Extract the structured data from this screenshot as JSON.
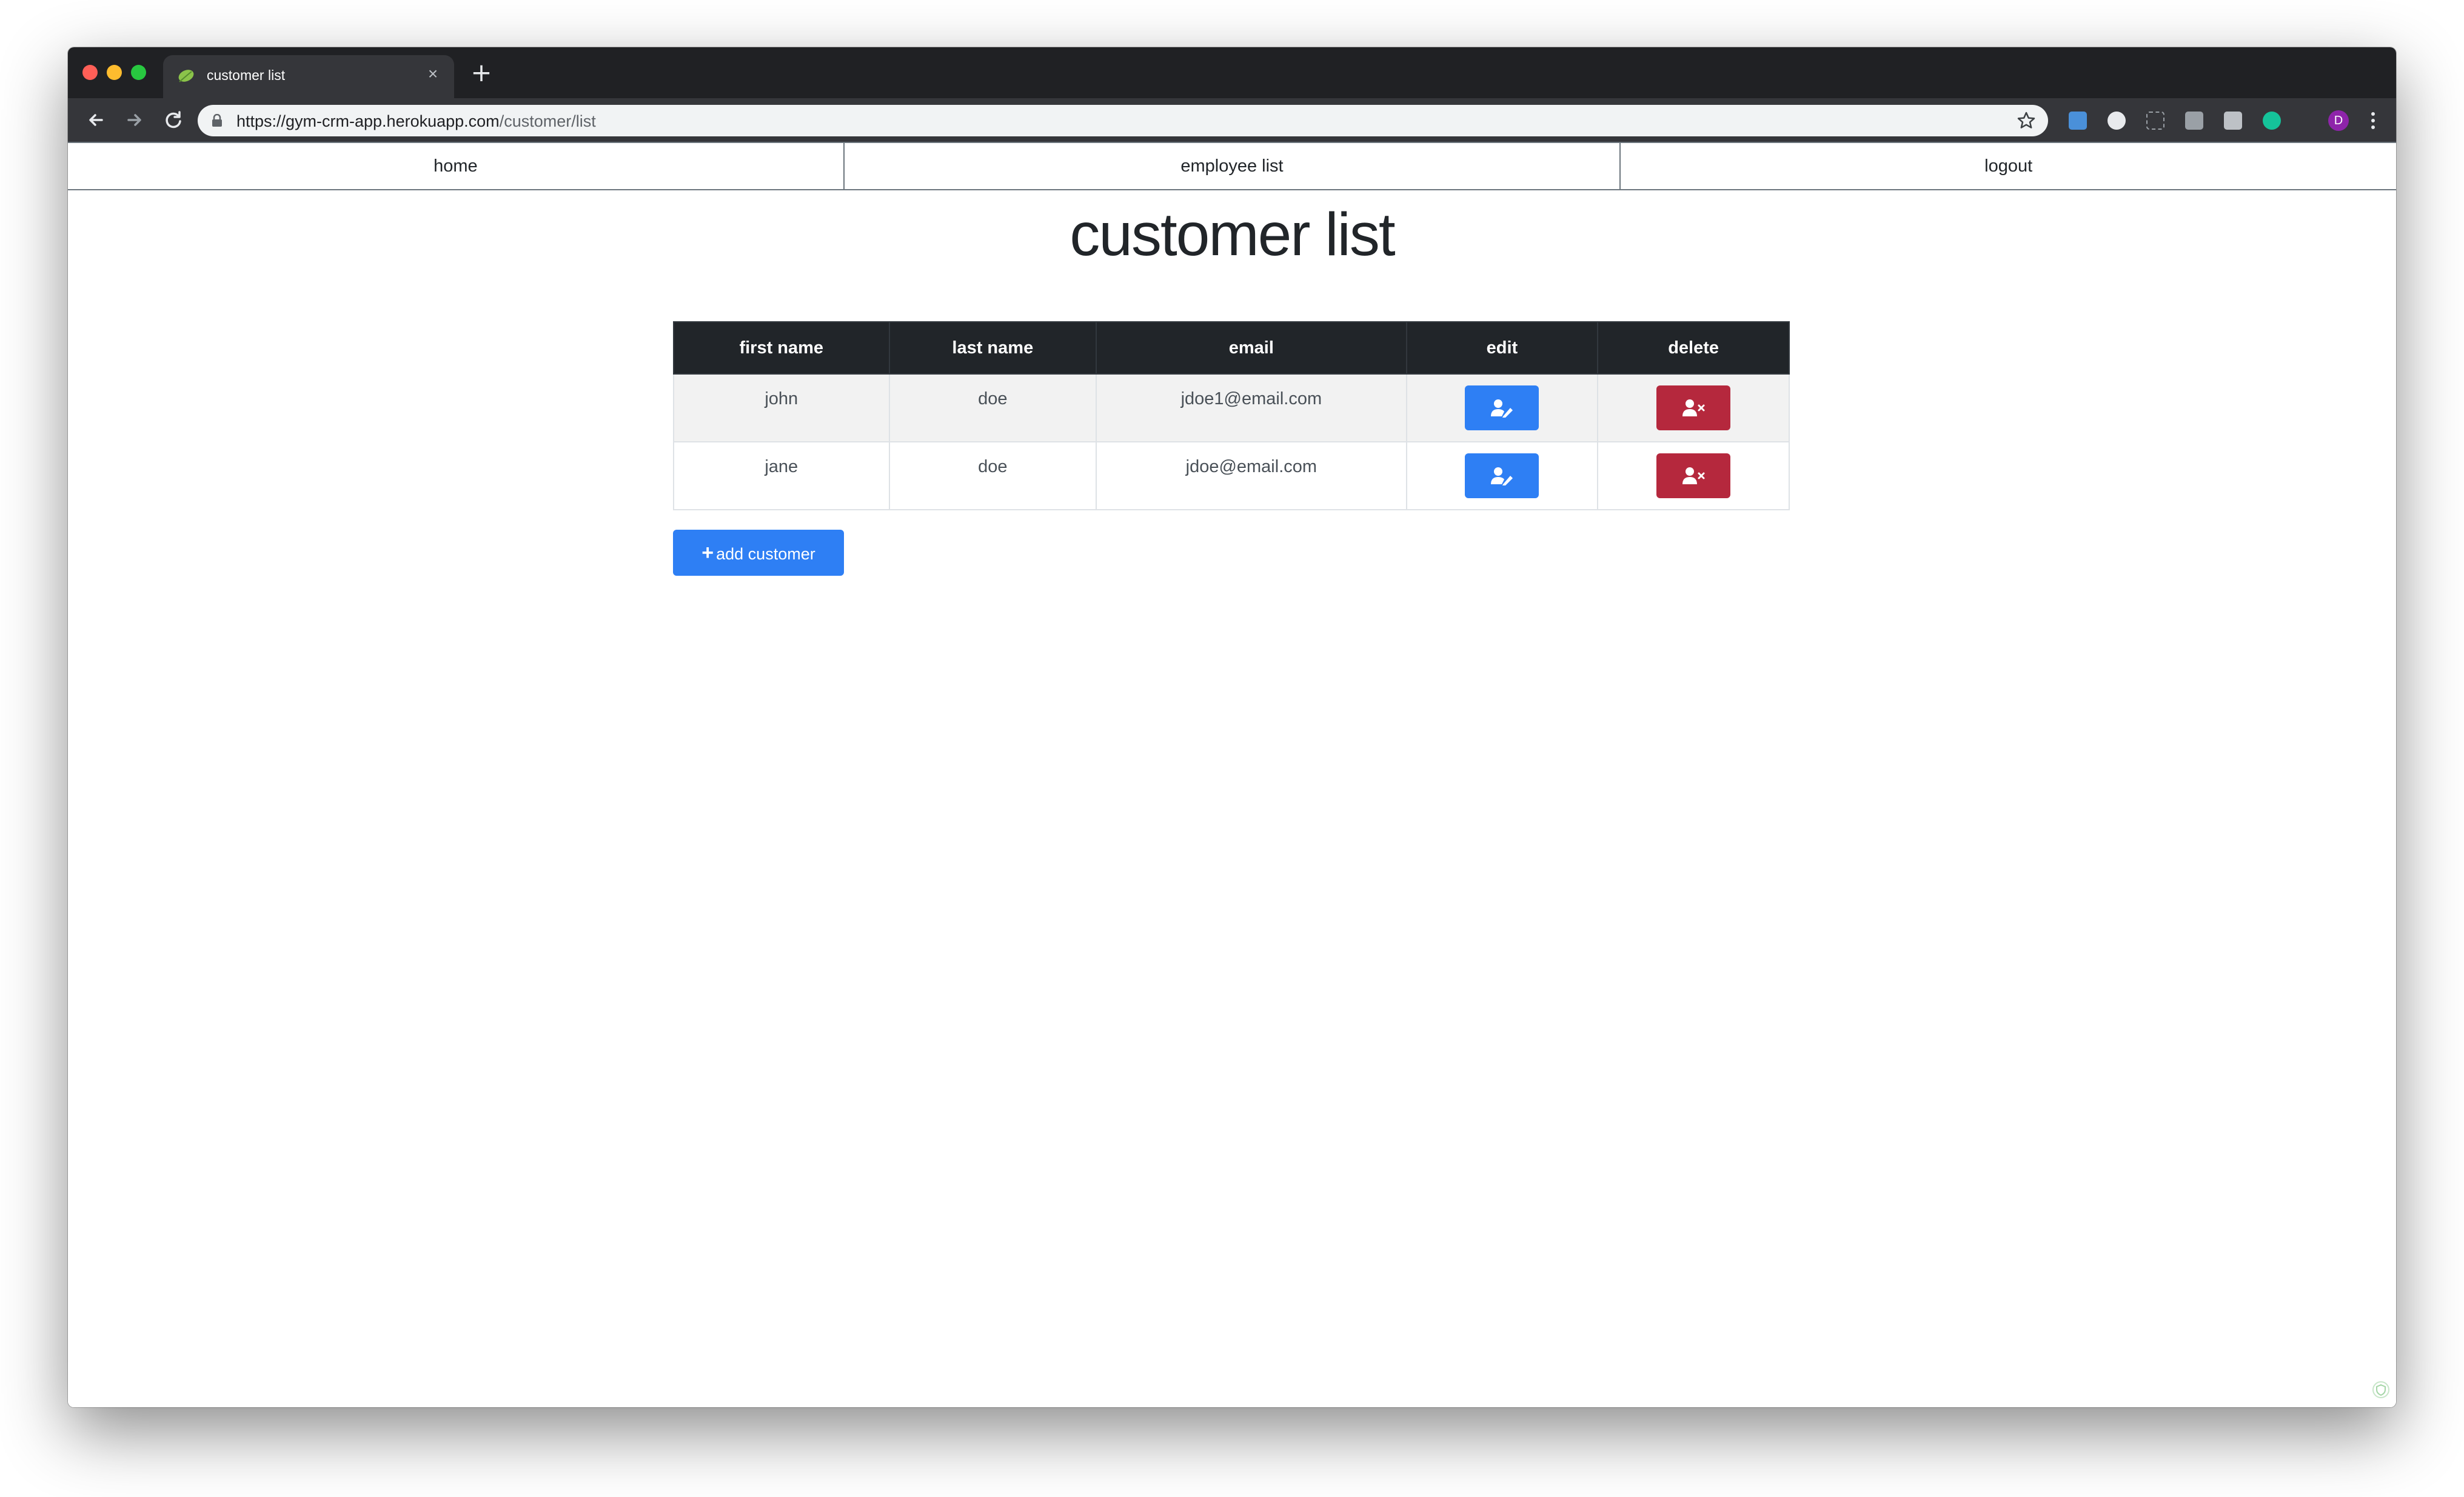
{
  "browser": {
    "tab_title": "customer list",
    "new_tab_label": "+",
    "close_label": "×",
    "url_host": "https://gym-crm-app.herokuapp.com",
    "url_path": "/customer/list",
    "profile_initial": "D"
  },
  "nav": {
    "home": "home",
    "employee_list": "employee list",
    "logout": "logout"
  },
  "page": {
    "title": "customer list"
  },
  "table": {
    "headers": [
      "first name",
      "last name",
      "email",
      "edit",
      "delete"
    ],
    "rows": [
      {
        "first_name": "john",
        "last_name": "doe",
        "email": "jdoe1@email.com"
      },
      {
        "first_name": "jane",
        "last_name": "doe",
        "email": "jdoe@email.com"
      }
    ]
  },
  "add_button": {
    "icon": "+",
    "label": "add customer"
  },
  "colors": {
    "primary": "#2e7ff4",
    "danger": "#b5283d",
    "header": "#212529"
  }
}
